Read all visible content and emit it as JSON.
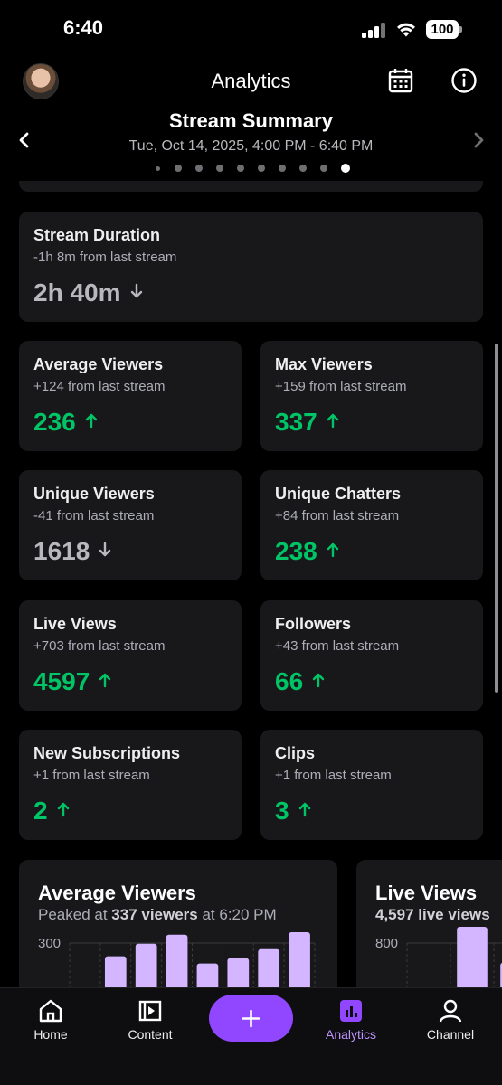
{
  "status_bar": {
    "time": "6:40",
    "battery": "100"
  },
  "header": {
    "title": "Analytics",
    "summary_title": "Stream Summary",
    "date_range": "Tue, Oct 14, 2025, 4:00 PM - 6:40 PM",
    "page_dots": 10,
    "active_dot": 9
  },
  "stream_duration": {
    "label": "Stream Duration",
    "change": "-1h 8m from last stream",
    "value": "2h 40m",
    "trend": "down"
  },
  "metrics": [
    {
      "label": "Average Viewers",
      "change": "+124 from last stream",
      "value": "236",
      "trend": "up"
    },
    {
      "label": "Max Viewers",
      "change": "+159 from last stream",
      "value": "337",
      "trend": "up"
    },
    {
      "label": "Unique Viewers",
      "change": "-41 from last stream",
      "value": "1618",
      "trend": "down"
    },
    {
      "label": "Unique Chatters",
      "change": "+84 from last stream",
      "value": "238",
      "trend": "up"
    },
    {
      "label": "Live Views",
      "change": "+703 from last stream",
      "value": "4597",
      "trend": "up"
    },
    {
      "label": "Followers",
      "change": "+43 from last stream",
      "value": "66",
      "trend": "up"
    },
    {
      "label": "New Subscriptions",
      "change": "+1 from last stream",
      "value": "2",
      "trend": "up"
    },
    {
      "label": "Clips",
      "change": "+1 from last stream",
      "value": "3",
      "trend": "up"
    }
  ],
  "charts": [
    {
      "title": "Average Viewers",
      "sub_prefix": "Peaked at ",
      "sub_bold": "337 viewers",
      "sub_suffix": " at 6:20 PM",
      "y_label": "300"
    },
    {
      "title": "Live Views",
      "sub_bold": "4,597 live views",
      "y_label": "800"
    }
  ],
  "chart_data": [
    {
      "type": "bar",
      "title": "Average Viewers",
      "categories": [
        "1",
        "2",
        "3",
        "4",
        "5",
        "6",
        "7",
        "8"
      ],
      "values": [
        null,
        270,
        305,
        330,
        250,
        265,
        290,
        337
      ],
      "ylim": [
        0,
        337
      ]
    },
    {
      "type": "bar",
      "title": "Live Views",
      "categories": [
        "1",
        "2",
        "3"
      ],
      "values": [
        null,
        950,
        600
      ],
      "ylim": [
        0,
        950
      ]
    }
  ],
  "nav": {
    "items": [
      {
        "label": "Home",
        "icon": "home-icon"
      },
      {
        "label": "Content",
        "icon": "content-icon"
      },
      {
        "label": "Analytics",
        "icon": "analytics-icon",
        "active": true
      },
      {
        "label": "Channel",
        "icon": "channel-icon"
      }
    ],
    "fab_icon": "plus-icon"
  },
  "colors": {
    "up": "#00c566",
    "down": "#b8b8bd",
    "accent": "#9147ff",
    "bar": "#d4b5ff",
    "card": "#18181b"
  }
}
